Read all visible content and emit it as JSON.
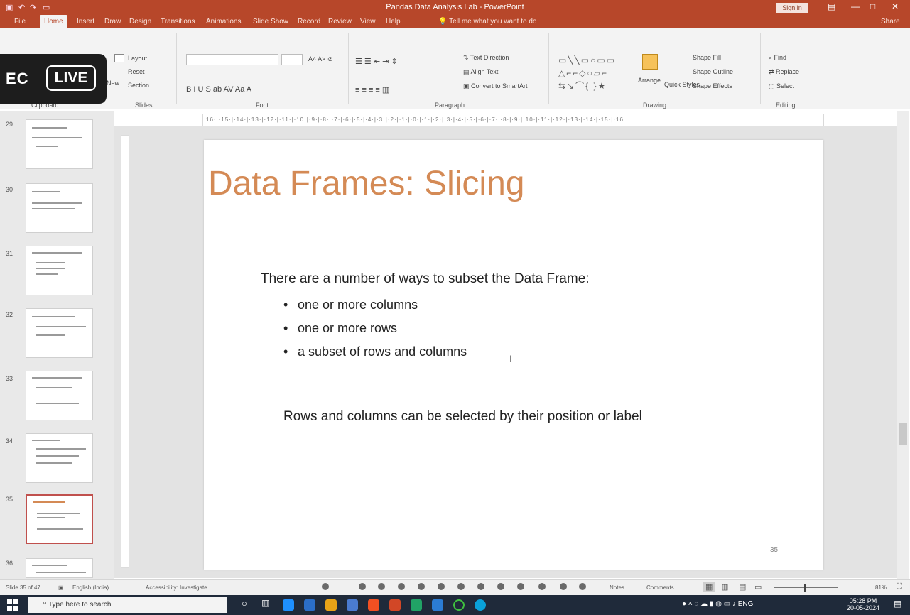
{
  "window": {
    "title": "Pandas Data Analysis Lab - PowerPoint",
    "sign_in": "Sign in",
    "win_controls": [
      "—",
      "□",
      "✕"
    ]
  },
  "tabs": [
    "File",
    "Home",
    "Insert",
    "Draw",
    "Design",
    "Transitions",
    "Animations",
    "Slide Show",
    "Record",
    "Review",
    "View",
    "Help"
  ],
  "active_tab_index": 1,
  "tell_me": "Tell me what you want to do",
  "share_label": "Share",
  "ribbon": {
    "groups": [
      "Clipboard",
      "Slides",
      "Font",
      "Paragraph",
      "Drawing",
      "Editing"
    ],
    "slides_items": [
      "Layout",
      "Reset",
      "Section"
    ],
    "new_slide_label": "New",
    "drawing_arrange": "Arrange",
    "drawing_quick": "Quick Styles",
    "drawing_items": [
      "Shape Fill",
      "Shape Outline",
      "Shape Effects"
    ],
    "editing_items": [
      "Find",
      "Replace",
      "Select"
    ]
  },
  "overlay": {
    "rec": "EC",
    "live": "LIVE"
  },
  "ruler_text": "16·|·15·|·14·|·13·|·12·|·11·|·10·|·9·|·8·|·7·|·6·|·5·|·4·|·3·|·2·|·1·|·0·|·1·|·2·|·3·|·4·|·5·|·6·|·7·|·8·|·9·|·10·|·11·|·12·|·13·|·14·|·15·|·16",
  "thumbnails": [
    {
      "num": "29",
      "active": false
    },
    {
      "num": "30",
      "active": false
    },
    {
      "num": "31",
      "active": false
    },
    {
      "num": "32",
      "active": false
    },
    {
      "num": "33",
      "active": false
    },
    {
      "num": "34",
      "active": false
    },
    {
      "num": "35",
      "active": true
    },
    {
      "num": "36",
      "active": false
    }
  ],
  "slide": {
    "title": "Data Frames: Slicing",
    "intro": "There are a number of ways to subset the Data Frame:",
    "bullets": [
      "one or more columns",
      "one or more rows",
      "a subset of rows and columns"
    ],
    "note": "Rows and columns can be selected by their position or label",
    "number": "35"
  },
  "status": {
    "slide_of": "Slide 35 of 47",
    "language": "English (India)",
    "accessibility": "Accessibility: Investigate",
    "notes": "Notes",
    "comments": "Comments",
    "zoom": "81%"
  },
  "taskbar": {
    "search_placeholder": "Type here to search",
    "time": "05:28 PM",
    "date": "20-05-2024"
  }
}
